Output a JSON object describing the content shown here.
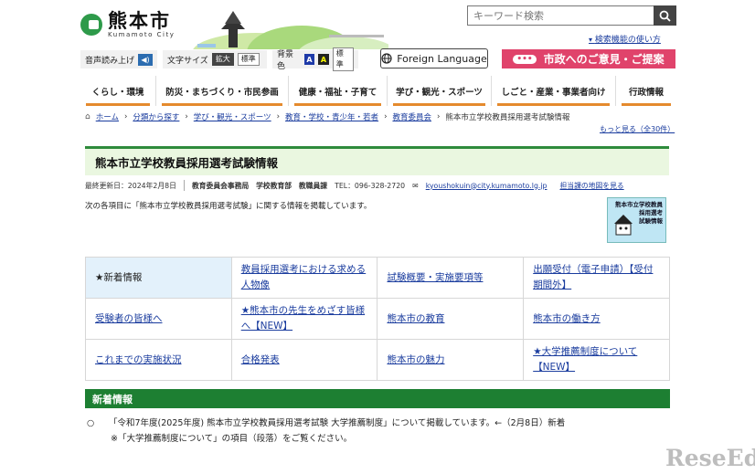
{
  "header": {
    "logo_jp": "熊本市",
    "logo_en": "Kumamoto City",
    "search_placeholder": "キーワード検索",
    "search_help": "検索機能の使い方",
    "tools": {
      "speech_label": "音声読み上げ",
      "font_size_label": "文字サイズ",
      "font_enlarge": "拡大",
      "font_standard": "標準",
      "bg_color_label": "背景色",
      "bg_a1": "A",
      "bg_a2": "A",
      "bg_standard": "標準"
    },
    "foreign_language": "Foreign Language",
    "opinion_button": "市政へのご意見・ご提案"
  },
  "nav": [
    {
      "label": "くらし・環境"
    },
    {
      "label": "防災・まちづくり・市民参画"
    },
    {
      "label": "健康・福祉・子育て"
    },
    {
      "label": "学び・観光・スポーツ"
    },
    {
      "label": "しごと・産業・事業者向け"
    },
    {
      "label": "行政情報"
    }
  ],
  "breadcrumb": [
    "ホーム",
    "分類から探す",
    "学び・観光・スポーツ",
    "教育・学校・青少年・若者",
    "教育委員会",
    "熊本市立学校教員採用選考試験情報"
  ],
  "more_link": "もっと見る（全30件）",
  "page": {
    "title": "熊本市立学校教員採用選考試験情報",
    "updated": "最終更新日：2024年2月8日",
    "dept": "教育委員会事務局　学校教育部　教職員課",
    "tel": "TEL：096-328-2720",
    "email": "kyoushokuin@city.kumamoto.lg.jp",
    "map_link": "担当課の地図を見る",
    "intro": "次の各項目に「熊本市立学校教員採用選考試験」に関する情報を掲載しています。",
    "badge_lines": [
      "熊本市立学校教員",
      "採用選考",
      "試験情報"
    ]
  },
  "links_table": [
    [
      "★新着情報",
      "教員採用選考における求める人物像",
      "試験概要・実施要項等",
      "出願受付（電子申請）【受付期間外】"
    ],
    [
      "受験者の皆様へ",
      "★熊本市の先生をめざす皆様へ【NEW】",
      "熊本市の教育",
      "熊本市の働き方"
    ],
    [
      "これまでの実施状況",
      "合格発表",
      "熊本市の魅力",
      "★大学推薦制度について【NEW】"
    ]
  ],
  "news": {
    "heading": "新着情報",
    "bullet": "○",
    "item": "「令和7年度(2025年度) 熊本市立学校教員採用選考試験 大学推薦制度」について掲載しています。←（2月8日）新着",
    "note": "※「大学推薦制度について」の項目（段落）をご覧ください。"
  },
  "watermark": "ReseEd",
  "colors": {
    "accent_green": "#1d7f32",
    "title_bg": "#eaf7e0",
    "opinion_pink": "#e0436b",
    "nav_underline": "#e58a2d",
    "link_blue": "#1a3c9e"
  }
}
